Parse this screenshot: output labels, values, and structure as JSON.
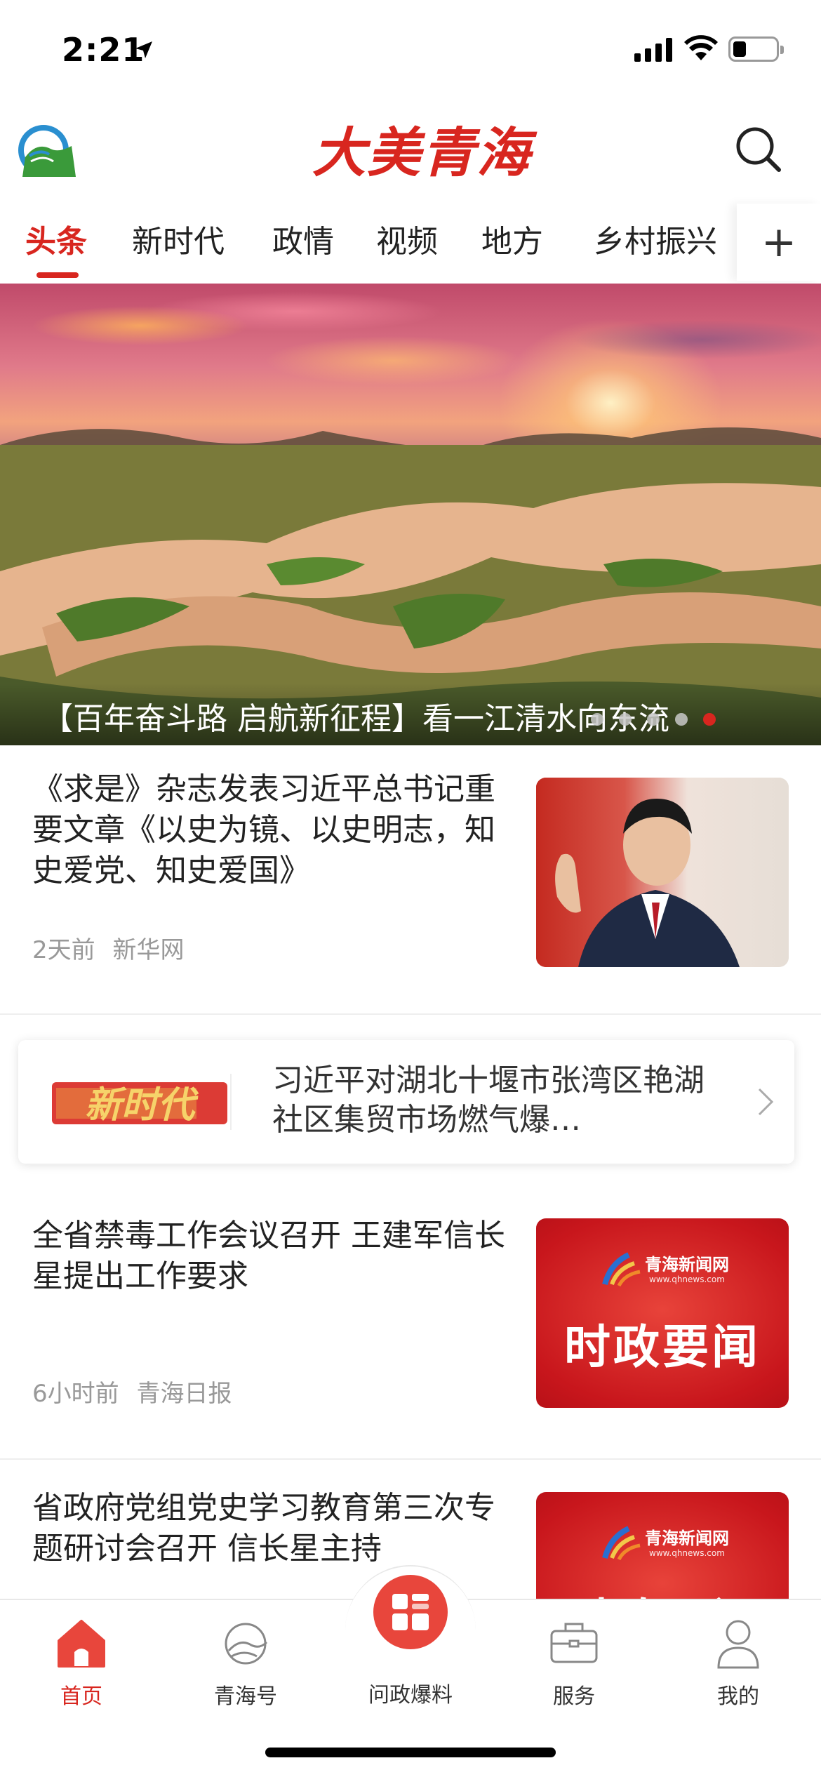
{
  "status_bar": {
    "time": "2:21"
  },
  "header": {
    "brand": "大美青海"
  },
  "tabs": [
    {
      "label": "头条",
      "active": true
    },
    {
      "label": "新时代",
      "active": false
    },
    {
      "label": "政情",
      "active": false
    },
    {
      "label": "视频",
      "active": false
    },
    {
      "label": "地方",
      "active": false
    },
    {
      "label": "乡村振兴",
      "active": false
    }
  ],
  "tab_more": "+",
  "banner": {
    "caption": "【百年奋斗路 启航新征程】看一江清水向东流",
    "slide_count": 5,
    "active_slide": 5
  },
  "news": [
    {
      "title": "《求是》杂志发表习近平总书记重要文章《以史为镜、以史明志，知史爱党、知史爱国》",
      "time": "2天前",
      "source": "新华网"
    },
    {
      "title": "全省禁毒工作会议召开 王建军信长星提出工作要求",
      "time": "6小时前",
      "source": "青海日报",
      "thumb": {
        "site": "青海新闻网",
        "url": "www.qhnews.com",
        "title": "时政要闻"
      }
    },
    {
      "title": "省政府党组党史学习教育第三次专题研讨会召开 信长星主持",
      "thumb": {
        "site": "青海新闻网",
        "url": "www.qhnews.com",
        "title": "时政要闻"
      }
    }
  ],
  "topic_card": {
    "logo_text": "新时代",
    "text": "习近平对湖北十堰市张湾区艳湖社区集贸市场燃气爆…"
  },
  "tabbar": [
    {
      "label": "首页",
      "icon": "home-icon",
      "active": true
    },
    {
      "label": "青海号",
      "icon": "qinghai-account-icon",
      "active": false
    },
    {
      "label": "问政爆料",
      "icon": "report-grid-icon",
      "active": false
    },
    {
      "label": "服务",
      "icon": "briefcase-icon",
      "active": false
    },
    {
      "label": "我的",
      "icon": "user-icon",
      "active": false
    }
  ],
  "colors": {
    "accent": "#d8261f",
    "meta": "#999999"
  }
}
